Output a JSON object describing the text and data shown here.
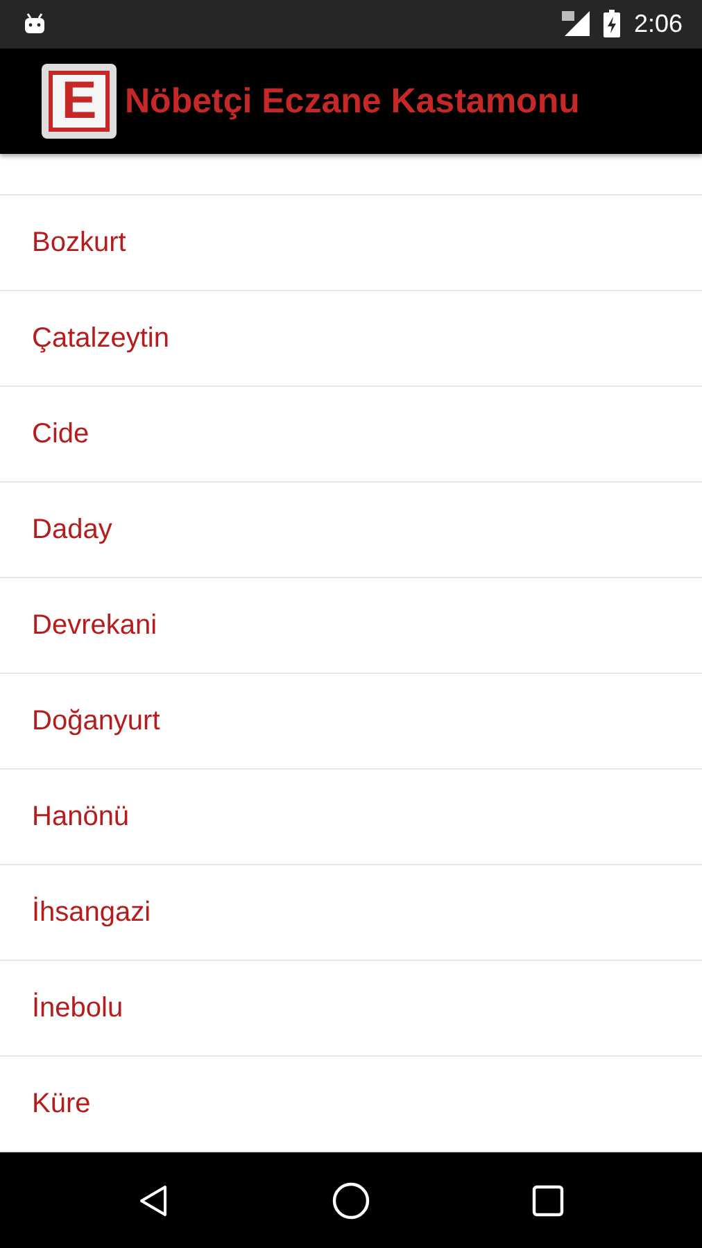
{
  "status_bar": {
    "time": "2:06"
  },
  "app_bar": {
    "logo_letter": "E",
    "title": "Nöbetçi Eczane Kastamonu"
  },
  "districts": [
    {
      "name": "Bozkurt"
    },
    {
      "name": "Çatalzeytin"
    },
    {
      "name": "Cide"
    },
    {
      "name": "Daday"
    },
    {
      "name": "Devrekani"
    },
    {
      "name": "Doğanyurt"
    },
    {
      "name": "Hanönü"
    },
    {
      "name": "İhsangazi"
    },
    {
      "name": "İnebolu"
    },
    {
      "name": "Küre"
    }
  ]
}
